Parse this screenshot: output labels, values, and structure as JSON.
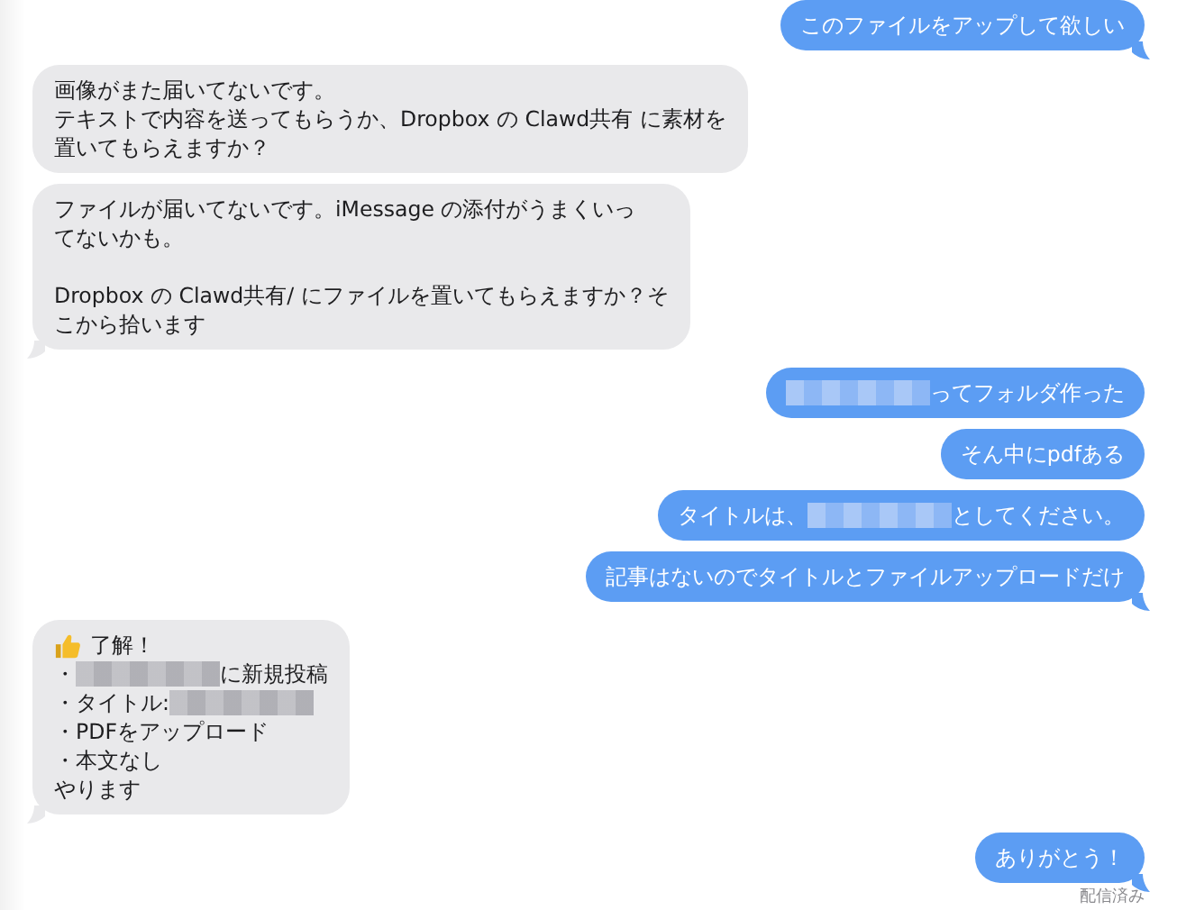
{
  "messages": [
    {
      "kind": "sent",
      "tail": true,
      "paragraphs": [
        [
          [
            {
              "kind": "text",
              "text": "このファイルをアップして欲しい"
            }
          ]
        ]
      ]
    },
    {
      "kind": "received",
      "tail": false,
      "paragraphs": [
        [
          [
            {
              "kind": "text",
              "text": "画像がまた届いてないです。"
            }
          ],
          [
            {
              "kind": "text",
              "text": "テキストで内容を送ってもらうか、Dropbox の Clawd共有 に素材を"
            }
          ],
          [
            {
              "kind": "text",
              "text": "置いてもらえますか？"
            }
          ]
        ]
      ]
    },
    {
      "kind": "received",
      "tail": true,
      "paragraphs": [
        [
          [
            {
              "kind": "text",
              "text": "ファイルが届いてないです。iMessage の添付がうまくいっ"
            }
          ],
          [
            {
              "kind": "text",
              "text": "てないかも。"
            }
          ]
        ],
        [
          [
            {
              "kind": "text",
              "text": "Dropbox の Clawd共有/ にファイルを置いてもらえますか？そ"
            }
          ],
          [
            {
              "kind": "text",
              "text": "こから拾います"
            }
          ]
        ]
      ]
    },
    {
      "kind": "sent",
      "tail": false,
      "paragraphs": [
        [
          [
            {
              "kind": "redacted"
            },
            {
              "kind": "text",
              "text": "ってフォルダ作った"
            }
          ]
        ]
      ]
    },
    {
      "kind": "sent",
      "tail": false,
      "paragraphs": [
        [
          [
            {
              "kind": "text",
              "text": "そん中にpdfある"
            }
          ]
        ]
      ]
    },
    {
      "kind": "sent",
      "tail": false,
      "paragraphs": [
        [
          [
            {
              "kind": "text",
              "text": "タイトルは、"
            },
            {
              "kind": "redacted"
            },
            {
              "kind": "text",
              "text": "としてください。"
            }
          ]
        ]
      ]
    },
    {
      "kind": "sent",
      "tail": true,
      "paragraphs": [
        [
          [
            {
              "kind": "text",
              "text": "記事はないのでタイトルとファイルアップロードだけ"
            }
          ]
        ]
      ]
    },
    {
      "kind": "received",
      "tail": true,
      "paragraphs": [
        [
          [
            {
              "kind": "icon"
            },
            {
              "kind": "text",
              "text": "了解！"
            }
          ],
          [
            {
              "kind": "text",
              "text": "・"
            },
            {
              "kind": "redacted"
            },
            {
              "kind": "text",
              "text": "に新規投稿"
            }
          ],
          [
            {
              "kind": "text",
              "text": "・タイトル:"
            },
            {
              "kind": "redacted"
            }
          ],
          [
            {
              "kind": "text",
              "text": "・PDFをアップロード"
            }
          ],
          [
            {
              "kind": "text",
              "text": "・本文なし"
            }
          ],
          [
            {
              "kind": "text",
              "text": "やります"
            }
          ]
        ]
      ]
    },
    {
      "kind": "sent",
      "tail": true,
      "paragraphs": [
        [
          [
            {
              "kind": "text",
              "text": "ありがとう！"
            }
          ]
        ]
      ]
    }
  ],
  "status": "配信済み"
}
